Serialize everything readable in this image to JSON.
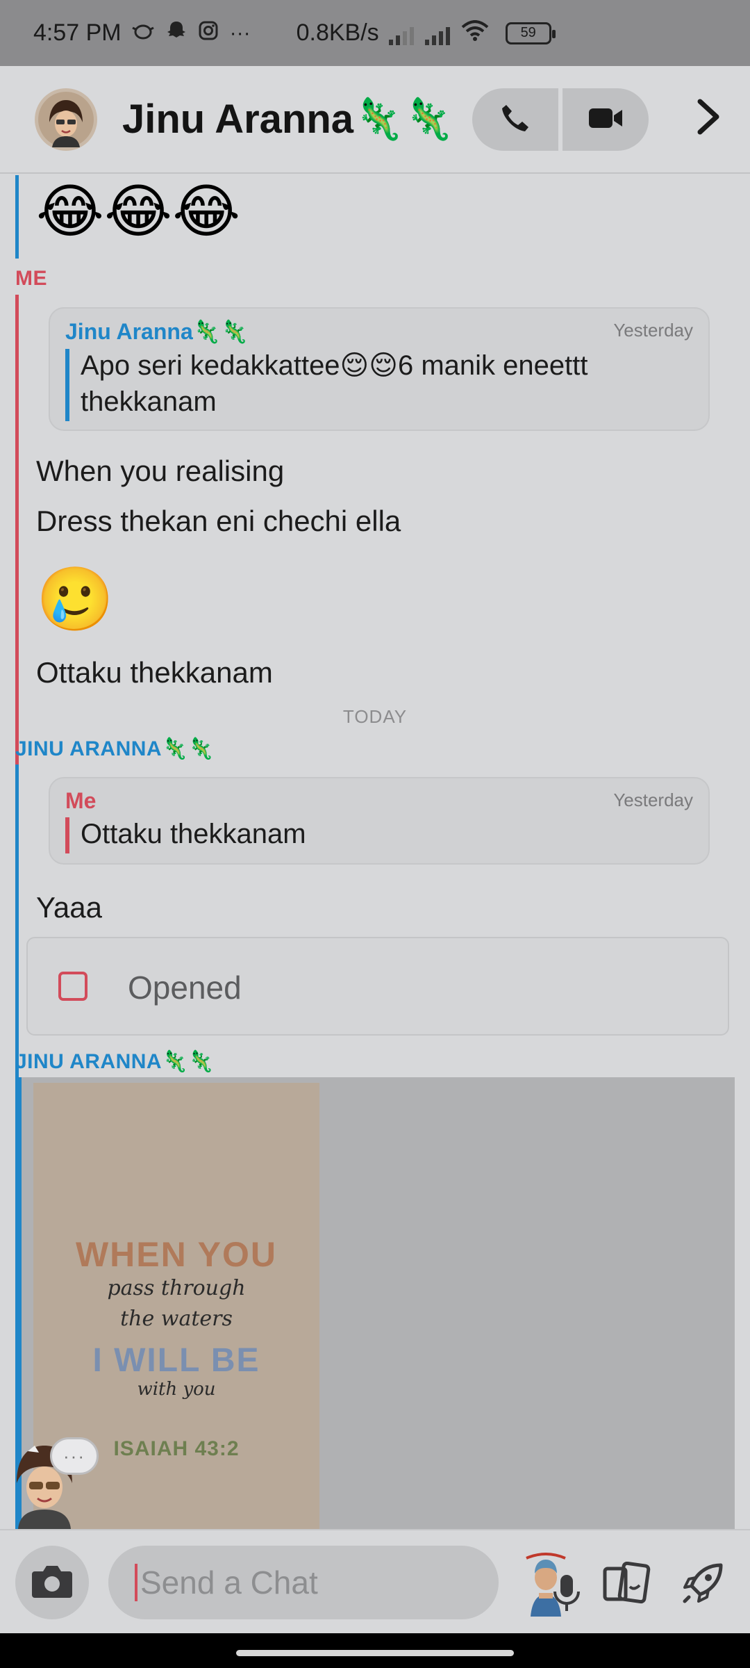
{
  "status_bar": {
    "time": "4:57 PM",
    "dots": "···",
    "speed": "0.8KB/s",
    "battery": "59"
  },
  "header": {
    "contact_name": "Jinu Aranna🦎🦎",
    "avatar_icon": "bitmoji-avatar",
    "call_icon": "phone-icon",
    "video_icon": "video-camera-icon",
    "more_icon": "chevron-right-icon"
  },
  "messages": {
    "top_emojis": "😂😂😂",
    "me_label": "ME",
    "quote1": {
      "name": "Jinu Aranna🦎🦎",
      "time": "Yesterday",
      "text_line1": "Apo seri kedakkattee😌😌6 manik eneettt",
      "text_line2": "thekkanam"
    },
    "me_msg1": "When you realising",
    "me_msg2": "Dress thekan eni chechi ella",
    "me_emoji": "🥲",
    "me_msg3": "Ottaku thekkanam",
    "today_divider": "TODAY",
    "jinu_label": "JINU ARANNA🦎🦎",
    "quote2": {
      "name": "Me",
      "time": "Yesterday",
      "text": "Ottaku thekkanam"
    },
    "jinu_msg1": "Yaaa",
    "opened_label": "Opened",
    "jinu_label2": "JINU ARANNA🦎🦎",
    "poster": {
      "line1": "WHEN YOU",
      "line2": "pass through",
      "line3": "the waters",
      "line4": "I WILL BE",
      "line5": "with you",
      "ref": "ISAIAH 43:2"
    },
    "typing_bubble": "···"
  },
  "composer": {
    "placeholder": "Send a Chat",
    "camera_icon": "camera-icon",
    "mic_icon": "microphone-icon",
    "bitmoji_icon": "bitmoji-sticker-icon",
    "cards_icon": "cards-icon",
    "rocket_icon": "rocket-icon"
  },
  "colors": {
    "me": "#d24b5a",
    "friend": "#1f86c8"
  }
}
